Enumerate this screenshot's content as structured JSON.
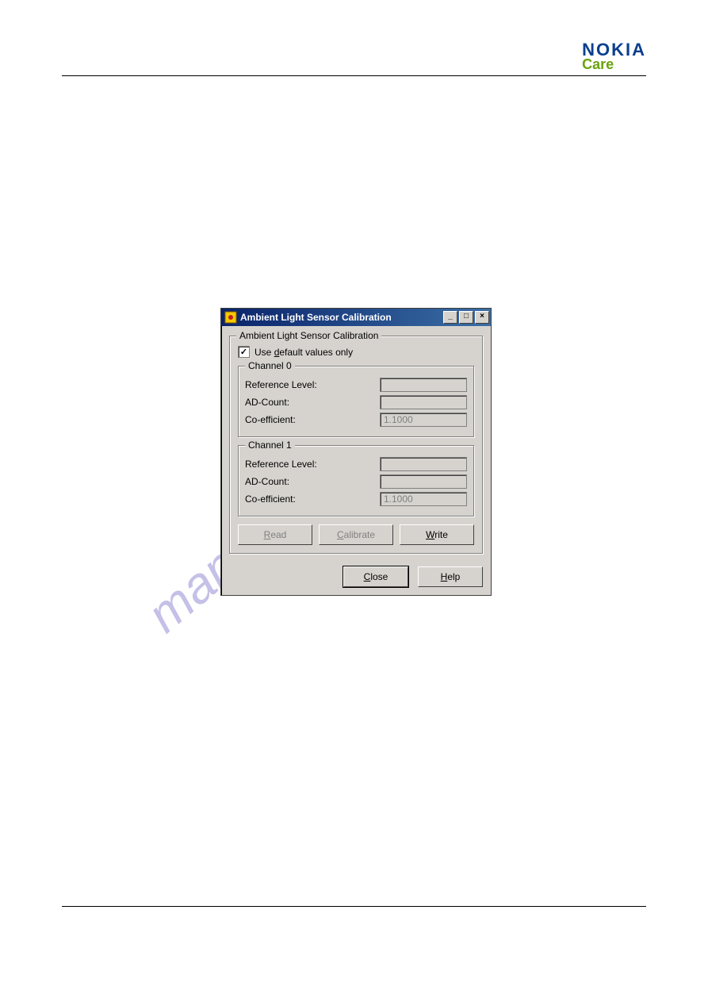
{
  "brand": {
    "name": "NOKIA",
    "sub": "Care"
  },
  "watermark": "manualshive.com",
  "dialog": {
    "title": "Ambient Light Sensor Calibration",
    "group_title": "Ambient Light Sensor Calibration",
    "checkbox": {
      "checked": true,
      "label_pre": "Use ",
      "label_ul": "d",
      "label_post": "efault values only"
    },
    "ch0": {
      "legend": "Channel 0",
      "ref_label": "Reference Level:",
      "ref_value": "",
      "ad_label": "AD-Count:",
      "ad_value": "",
      "coef_label": "Co-efficient:",
      "coef_value": "1.1000"
    },
    "ch1": {
      "legend": "Channel 1",
      "ref_label": "Reference Level:",
      "ref_value": "",
      "ad_label": "AD-Count:",
      "ad_value": "",
      "coef_label": "Co-efficient:",
      "coef_value": "1.1000"
    },
    "buttons": {
      "read_ul": "R",
      "read_rest": "ead",
      "calibrate_ul": "C",
      "calibrate_rest": "alibrate",
      "write_ul": "W",
      "write_rest": "rite",
      "close_ul": "C",
      "close_rest": "lose",
      "help_ul": "H",
      "help_rest": "elp"
    }
  }
}
